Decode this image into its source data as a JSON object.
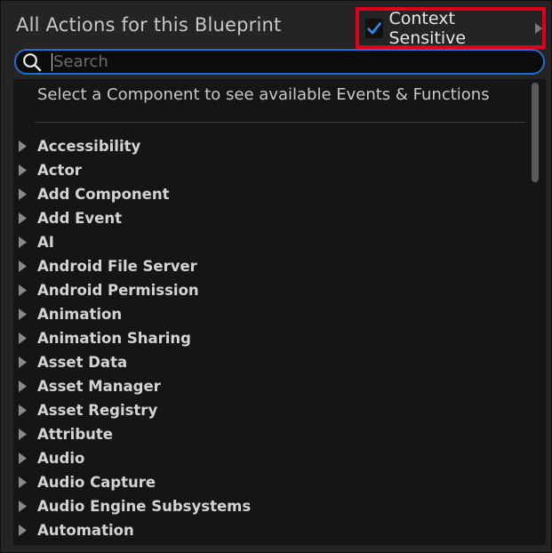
{
  "header": {
    "title": "All Actions for this Blueprint",
    "context_sensitive": {
      "label": "Context Sensitive",
      "checked": true
    }
  },
  "search": {
    "placeholder": "Search",
    "value": ""
  },
  "panel": {
    "hint": "Select a Component to see available Events & Functions",
    "categories": [
      {
        "label": "Accessibility"
      },
      {
        "label": "Actor"
      },
      {
        "label": "Add Component"
      },
      {
        "label": "Add Event"
      },
      {
        "label": "AI"
      },
      {
        "label": "Android File Server"
      },
      {
        "label": "Android Permission"
      },
      {
        "label": "Animation"
      },
      {
        "label": "Animation Sharing"
      },
      {
        "label": "Asset Data"
      },
      {
        "label": "Asset Manager"
      },
      {
        "label": "Asset Registry"
      },
      {
        "label": "Attribute"
      },
      {
        "label": "Audio"
      },
      {
        "label": "Audio Capture"
      },
      {
        "label": "Audio Engine Subsystems"
      },
      {
        "label": "Automation"
      }
    ]
  },
  "colors": {
    "accent": "#1c6fd6",
    "highlight_border": "#e0001a",
    "checkmark": "#2d8cf0"
  },
  "icons": {
    "checkbox": "checkmark-icon",
    "submenu": "triangle-right-icon",
    "search": "search-icon",
    "expand": "triangle-right-icon"
  }
}
